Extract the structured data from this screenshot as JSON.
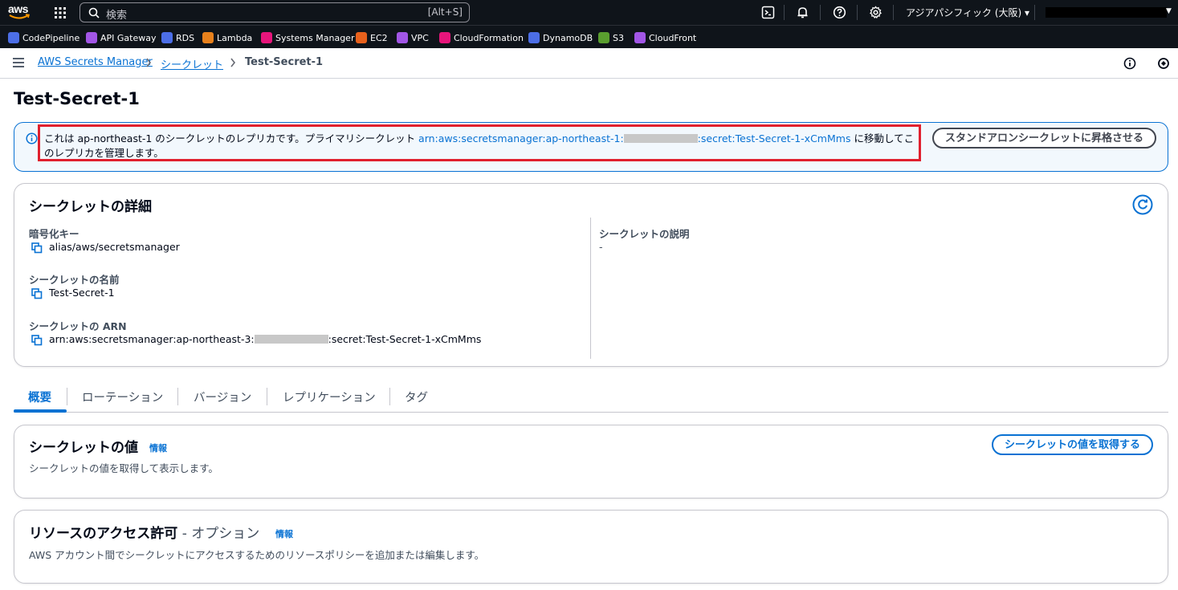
{
  "topnav": {
    "logo_text": "aws",
    "search_placeholder": "検索",
    "search_shortcut": "[Alt+S]",
    "region": "アジアパシフィック (大阪) ▾",
    "icons": [
      "cloudshell-icon",
      "bell-icon",
      "help-icon",
      "gear-icon"
    ]
  },
  "favorites": [
    {
      "label": "CodePipeline",
      "color": "#4c6ee6"
    },
    {
      "label": "API Gateway",
      "color": "#a256e6"
    },
    {
      "label": "RDS",
      "color": "#4c6ee6"
    },
    {
      "label": "Lambda",
      "color": "#e8811c"
    },
    {
      "label": "Systems Manager",
      "color": "#e7157b"
    },
    {
      "label": "EC2",
      "color": "#e8611c"
    },
    {
      "label": "VPC",
      "color": "#a256e6"
    },
    {
      "label": "CloudFormation",
      "color": "#e7157b"
    },
    {
      "label": "DynamoDB",
      "color": "#4c6ee6"
    },
    {
      "label": "S3",
      "color": "#5a9e2f"
    },
    {
      "label": "CloudFront",
      "color": "#a256e6"
    }
  ],
  "breadcrumb": {
    "items": [
      "AWS Secrets Manager",
      "シークレット",
      "Test-Secret-1"
    ]
  },
  "page_title": "Test-Secret-1",
  "banner": {
    "text_before": "これは ap-northeast-1 のシークレットのレプリカです。プライマリシークレット ",
    "arn_prefix": "arn:aws:secretsmanager:ap-northeast-1:",
    "arn_suffix": ":secret:Test-Secret-1-xCmMms",
    "text_after": " に移動してこのレプリカを管理します。",
    "button": "スタンドアロンシークレットに昇格させる"
  },
  "details": {
    "heading": "シークレットの詳細",
    "encryption_label": "暗号化キー",
    "encryption_value": "alias/aws/secretsmanager",
    "name_label": "シークレットの名前",
    "name_value": "Test-Secret-1",
    "arn_label": "シークレットの ARN",
    "arn_prefix": "arn:aws:secretsmanager:ap-northeast-3:",
    "arn_suffix": ":secret:Test-Secret-1-xCmMms",
    "description_label": "シークレットの説明",
    "description_value": "-"
  },
  "tabs": [
    "概要",
    "ローテーション",
    "バージョン",
    "レプリケーション",
    "タグ"
  ],
  "secret_value": {
    "heading": "シークレットの値",
    "info": "情報",
    "description": "シークレットの値を取得して表示します。",
    "button": "シークレットの値を取得する"
  },
  "resource_permissions": {
    "heading": "リソースのアクセス許可",
    "optional": " - オプション",
    "info": "情報",
    "description": "AWS アカウント間でシークレットにアクセスするためのリソースポリシーを追加または編集します。"
  }
}
